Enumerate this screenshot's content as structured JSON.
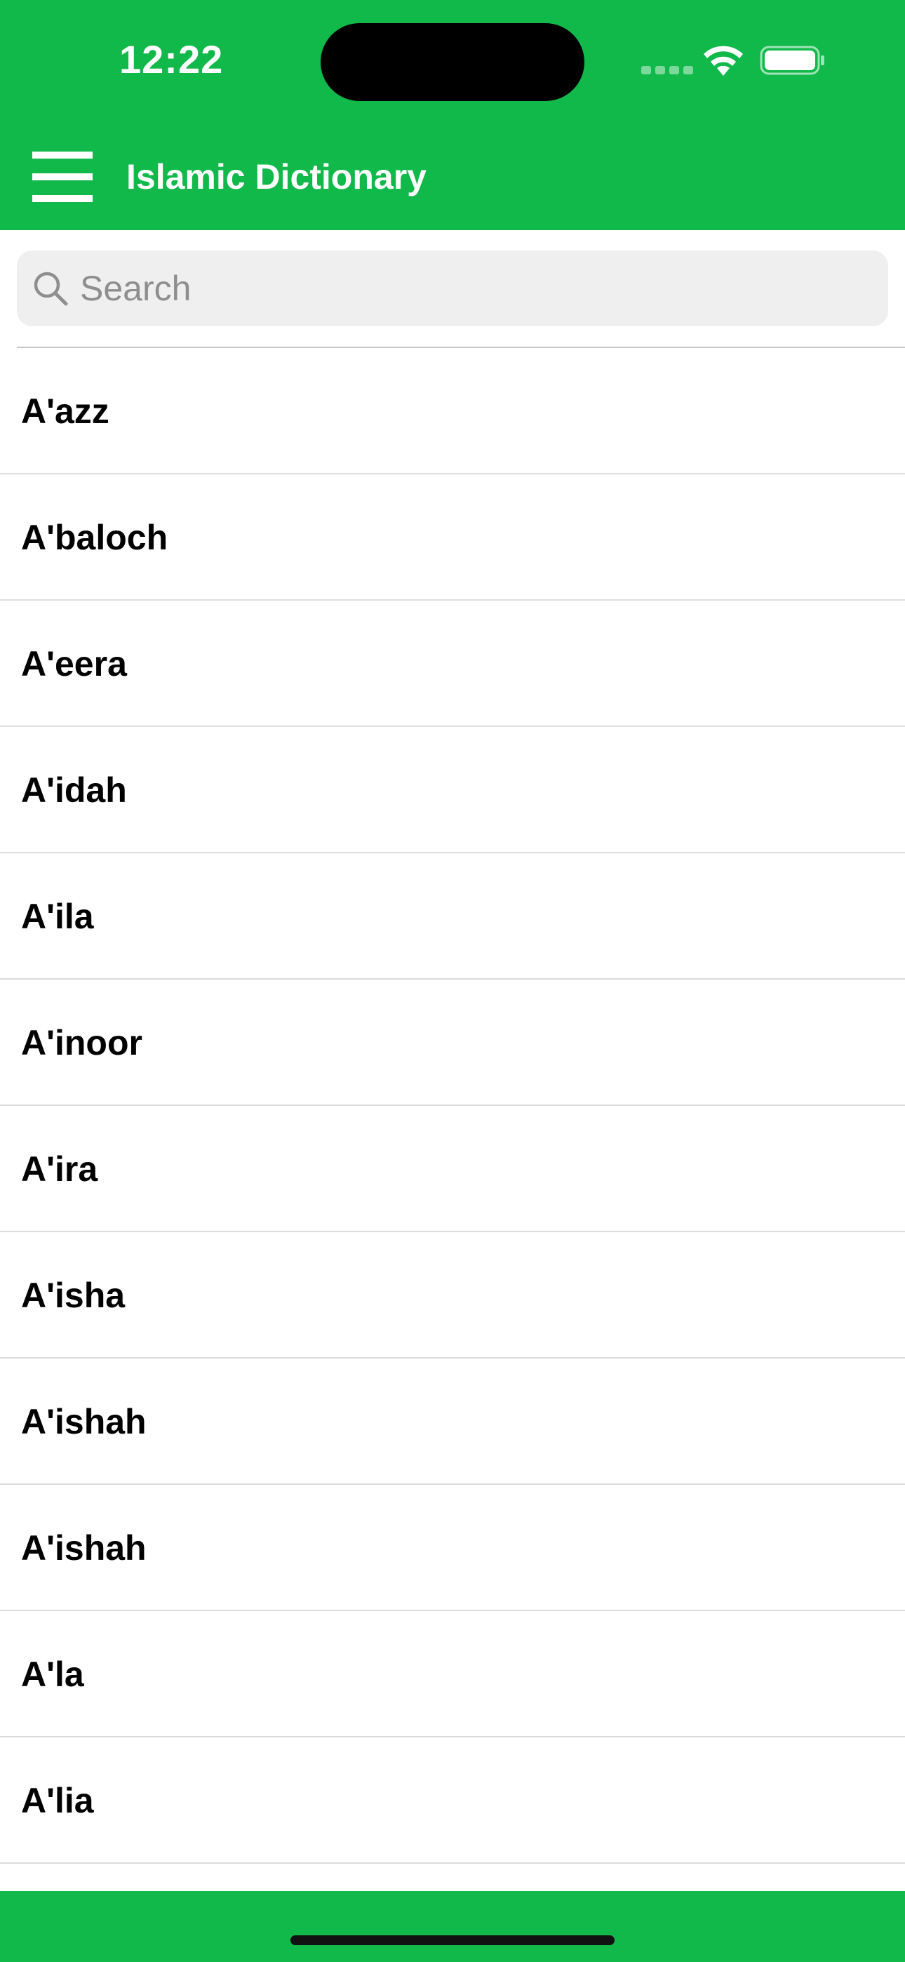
{
  "status_bar": {
    "time": "12:22"
  },
  "nav_bar": {
    "title": "Islamic Dictionary",
    "menu_icon": "hamburger-menu-icon"
  },
  "search": {
    "placeholder": "Search",
    "value": "",
    "icon": "search-icon"
  },
  "words": [
    "A'azz",
    "A'baloch",
    "A'eera",
    "A'idah",
    "A'ila",
    "A'inoor",
    "A'ira",
    "A'isha",
    "A'ishah",
    "A'ishah",
    "A'la",
    "A'lia"
  ],
  "colors": {
    "accent": "#11b84a",
    "search_bg": "#efefef",
    "divider": "#dcdcdc"
  }
}
